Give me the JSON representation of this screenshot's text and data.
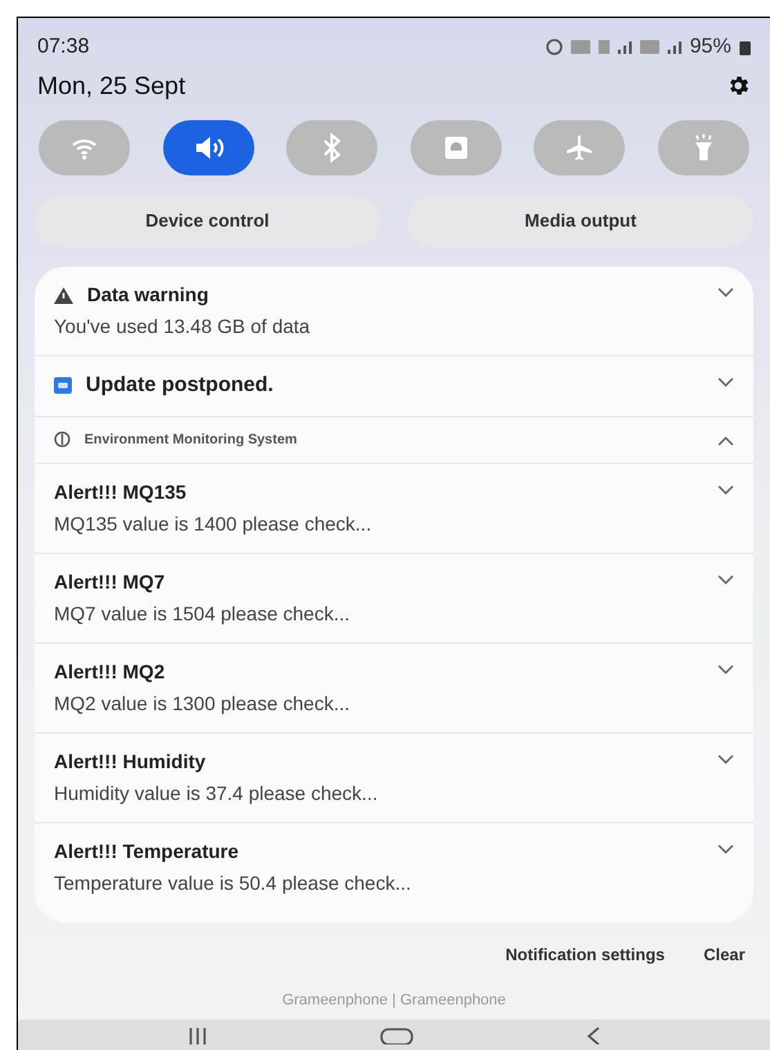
{
  "status_bar": {
    "time": "07:38",
    "battery": "95%"
  },
  "date": "Mon, 25 Sept",
  "quick_toggles": [
    {
      "kind": "wifi",
      "on": false
    },
    {
      "kind": "sound",
      "on": true
    },
    {
      "kind": "bluetooth",
      "on": false
    },
    {
      "kind": "lock",
      "on": false
    },
    {
      "kind": "airplane",
      "on": false
    },
    {
      "kind": "flashlight",
      "on": false
    }
  ],
  "panel_buttons": [
    "Device control",
    "Media output"
  ],
  "notifications": [
    {
      "kind": "warning",
      "title": "Data warning",
      "body": "You've used 13.48 GB of data",
      "expanded": false
    },
    {
      "kind": "update",
      "title": "Update postponed.",
      "expanded": false
    },
    {
      "kind": "group",
      "title": "Environment Monitoring System",
      "expanded": true
    },
    {
      "kind": "alert",
      "title": "Alert!!! MQ135",
      "body": "MQ135  value is 1400 please check...",
      "expanded": false
    },
    {
      "kind": "alert",
      "title": "Alert!!! MQ7",
      "body": "MQ7  value is 1504 please check...",
      "expanded": false
    },
    {
      "kind": "alert",
      "title": "Alert!!! MQ2",
      "body": "MQ2  value is 1300 please check...",
      "expanded": false
    },
    {
      "kind": "alert",
      "title": "Alert!!! Humidity",
      "body": "Humidity value is 37.4 please check...",
      "expanded": false
    },
    {
      "kind": "alert",
      "title": "Alert!!! Temperature",
      "body": "Temperature value is 50.4 please check...",
      "expanded": false
    }
  ],
  "footer_actions": [
    "Notification settings",
    "Clear"
  ],
  "carrier": "Grameenphone | Grameenphone"
}
